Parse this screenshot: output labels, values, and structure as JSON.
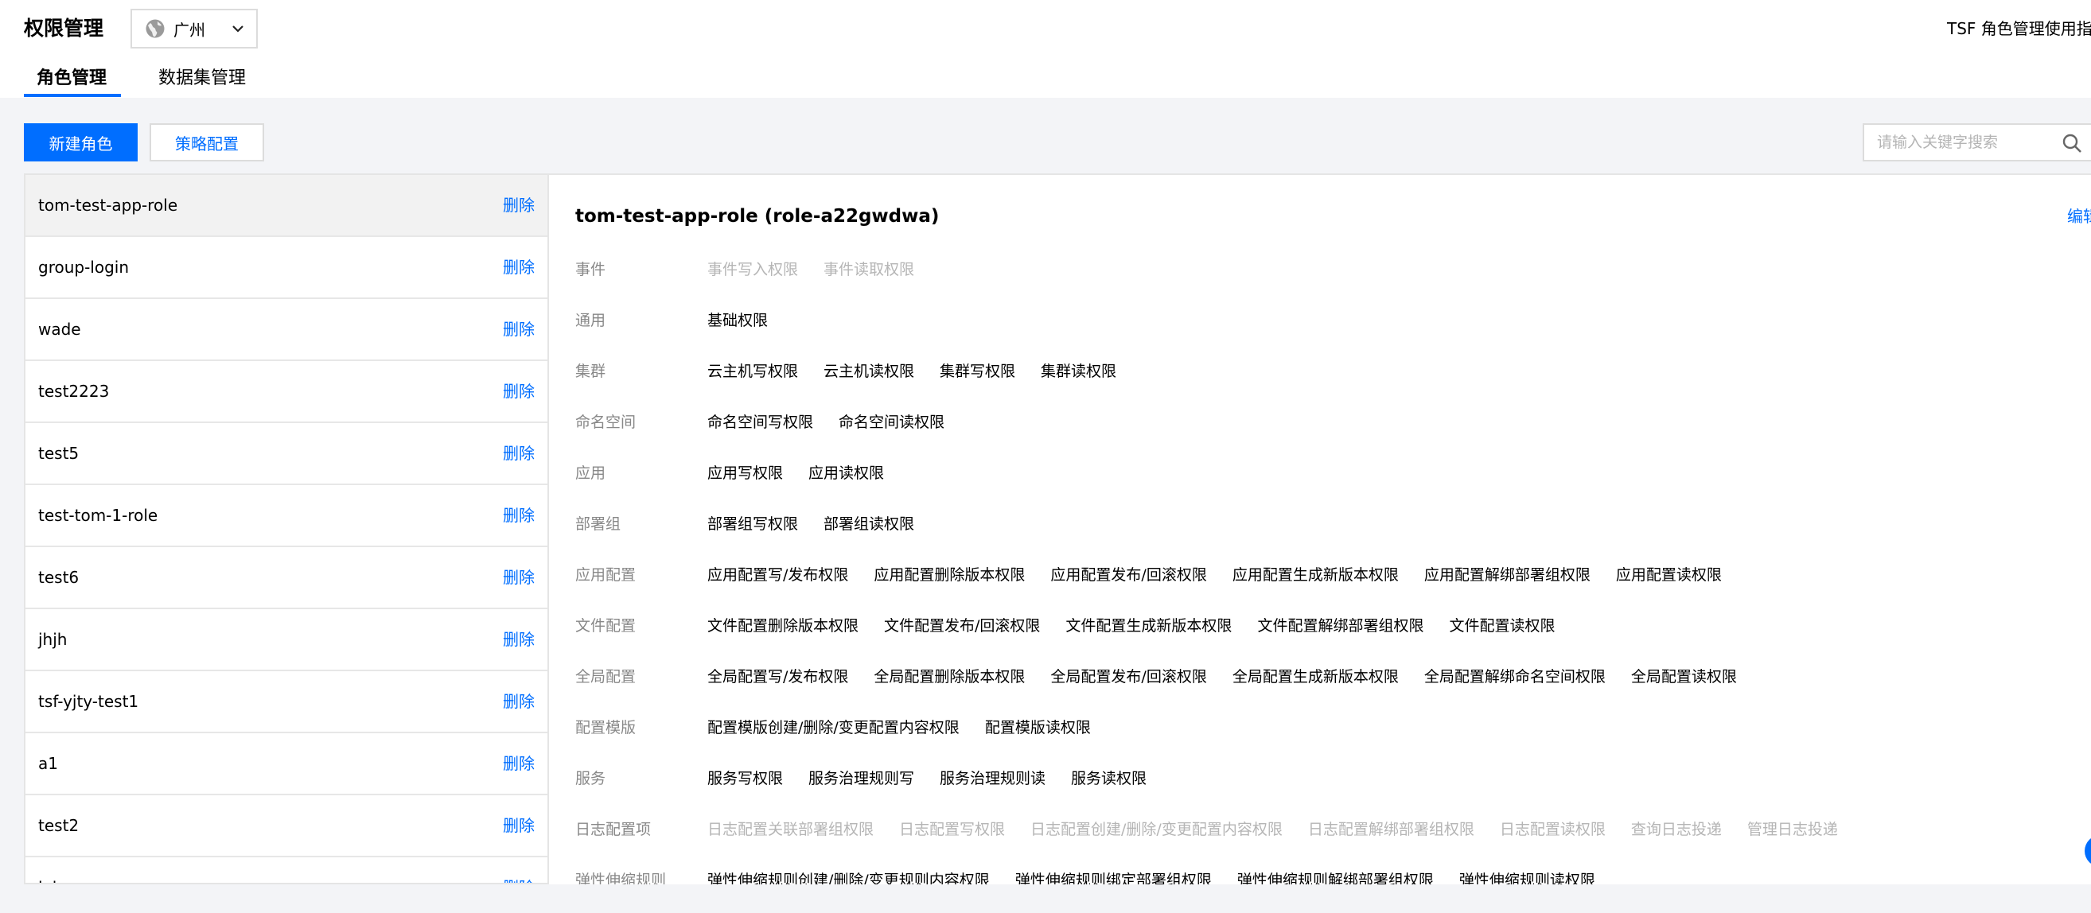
{
  "header": {
    "title": "权限管理",
    "region": "广州",
    "guide_link": "TSF 角色管理使用指引",
    "tabs": [
      {
        "label": "角色管理",
        "active": true
      },
      {
        "label": "数据集管理",
        "active": false
      }
    ]
  },
  "toolbar": {
    "new_role_label": "新建角色",
    "policy_label": "策略配置",
    "search_placeholder": "请输入关键字搜索"
  },
  "role_list": {
    "delete_label": "删除",
    "items": [
      {
        "name": "tom-test-app-role",
        "selected": true
      },
      {
        "name": "group-login"
      },
      {
        "name": "wade"
      },
      {
        "name": "test2223"
      },
      {
        "name": "test5"
      },
      {
        "name": "test-tom-1-role"
      },
      {
        "name": "test6"
      },
      {
        "name": "jhjh"
      },
      {
        "name": "tsf-yjty-test1"
      },
      {
        "name": "a1"
      },
      {
        "name": "test2"
      },
      {
        "name": "lol"
      }
    ]
  },
  "detail": {
    "title": "tom-test-app-role (role-a22gwdwa)",
    "edit_label": "编辑",
    "rows": [
      {
        "category": "事件",
        "enabled": false,
        "perms": [
          "事件写入权限",
          "事件读取权限"
        ]
      },
      {
        "category": "通用",
        "enabled": true,
        "perms": [
          "基础权限"
        ]
      },
      {
        "category": "集群",
        "enabled": true,
        "perms": [
          "云主机写权限",
          "云主机读权限",
          "集群写权限",
          "集群读权限"
        ]
      },
      {
        "category": "命名空间",
        "enabled": true,
        "perms": [
          "命名空间写权限",
          "命名空间读权限"
        ]
      },
      {
        "category": "应用",
        "enabled": true,
        "perms": [
          "应用写权限",
          "应用读权限"
        ]
      },
      {
        "category": "部署组",
        "enabled": true,
        "perms": [
          "部署组写权限",
          "部署组读权限"
        ]
      },
      {
        "category": "应用配置",
        "enabled": true,
        "perms": [
          "应用配置写/发布权限",
          "应用配置删除版本权限",
          "应用配置发布/回滚权限",
          "应用配置生成新版本权限",
          "应用配置解绑部署组权限",
          "应用配置读权限"
        ]
      },
      {
        "category": "文件配置",
        "enabled": true,
        "perms": [
          "文件配置删除版本权限",
          "文件配置发布/回滚权限",
          "文件配置生成新版本权限",
          "文件配置解绑部署组权限",
          "文件配置读权限"
        ]
      },
      {
        "category": "全局配置",
        "enabled": true,
        "perms": [
          "全局配置写/发布权限",
          "全局配置删除版本权限",
          "全局配置发布/回滚权限",
          "全局配置生成新版本权限",
          "全局配置解绑命名空间权限",
          "全局配置读权限"
        ]
      },
      {
        "category": "配置模版",
        "enabled": true,
        "perms": [
          "配置模版创建/删除/变更配置内容权限",
          "配置模版读权限"
        ]
      },
      {
        "category": "服务",
        "enabled": true,
        "perms": [
          "服务写权限",
          "服务治理规则写",
          "服务治理规则读",
          "服务读权限"
        ]
      },
      {
        "category": "日志配置项",
        "enabled": false,
        "perms": [
          "日志配置关联部署组权限",
          "日志配置写权限",
          "日志配置创建/删除/变更配置内容权限",
          "日志配置解绑部署组权限",
          "日志配置读权限",
          "查询日志投递",
          "管理日志投递"
        ]
      },
      {
        "category": "弹性伸缩规则",
        "enabled": true,
        "perms": [
          "弹性伸缩规则创建/删除/变更规则内容权限",
          "弹性伸缩规则绑定部署组权限",
          "弹性伸缩规则解绑部署组权限",
          "弹性伸缩规则读权限"
        ]
      }
    ]
  },
  "icons": {
    "region": "globe-icon",
    "dropdown": "chevron-down-icon",
    "search": "search-icon"
  },
  "colors": {
    "brand": "#006eff",
    "disabled_text": "#b5b5b5",
    "label_text": "#888888"
  }
}
